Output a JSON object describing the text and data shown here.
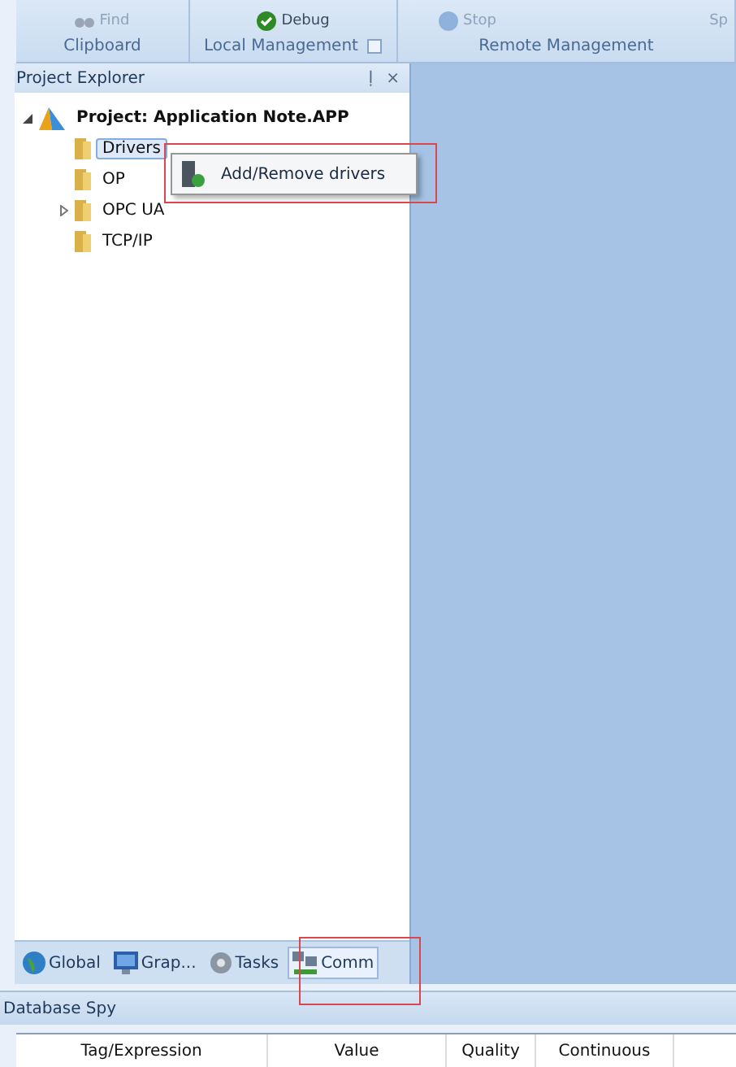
{
  "ribbon": {
    "tools": [
      {
        "label": "Find",
        "kind": "find"
      },
      {
        "label": "Debug",
        "kind": "debug"
      },
      {
        "label": "Stop",
        "kind": "stop"
      },
      {
        "label": "Sp",
        "kind": "plain"
      }
    ],
    "groups": [
      {
        "label": "Clipboard",
        "launcher": false
      },
      {
        "label": "Local Management",
        "launcher": true
      },
      {
        "label": "Remote Management",
        "launcher": false
      }
    ]
  },
  "project_explorer": {
    "title": "Project Explorer",
    "pin": "ḷ",
    "close": "×",
    "tree": [
      {
        "label": "Project: Application Note.APP",
        "kind": "project",
        "expanded": true,
        "selected": false,
        "children": [
          {
            "label": "Drivers",
            "kind": "folder",
            "selected": true
          },
          {
            "label": "OP",
            "kind": "folder",
            "selected": false
          },
          {
            "label": "OPC UA",
            "kind": "folder",
            "selected": false,
            "expanded": false
          },
          {
            "label": "TCP/IP",
            "kind": "folder",
            "selected": false
          }
        ]
      }
    ],
    "context_menu": {
      "items": [
        {
          "label": "Add/Remove drivers"
        }
      ]
    },
    "tabs": [
      {
        "label": "Global",
        "kind": "global",
        "selected": false
      },
      {
        "label": "Grap...",
        "kind": "graphics",
        "selected": false
      },
      {
        "label": "Tasks",
        "kind": "tasks",
        "selected": false
      },
      {
        "label": "Comm",
        "kind": "comm",
        "selected": true
      }
    ]
  },
  "database_spy": {
    "title": "Database Spy",
    "columns": [
      "Tag/Expression",
      "Value",
      "Quality",
      "Continuous"
    ]
  }
}
